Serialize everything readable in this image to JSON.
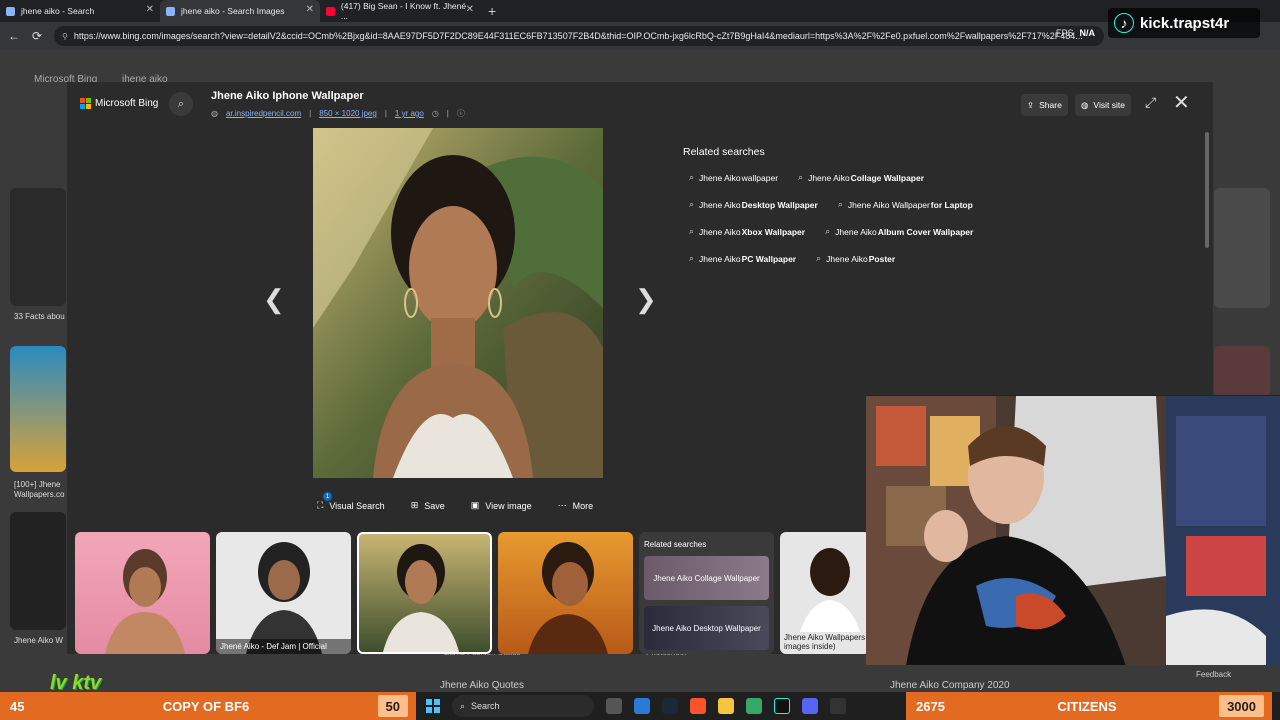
{
  "tabs": [
    {
      "title": "jhene aiko - Search",
      "active": false
    },
    {
      "title": "jhene aiko - Search Images",
      "active": true
    },
    {
      "title": "(417) Big Sean - I Know ft. Jhené ...",
      "active": false
    }
  ],
  "address": {
    "url": "https://www.bing.com/images/search?view=detailV2&ccid=OCmb%2Bjxg&id=8AAE97DF5D7F2DC89E44F311EC6FB713507F2B4D&thid=OIP.OCmb-jxg6lcRbQ-cZt7B9gHaI4&mediaurl=https%3A%2F%2Fe0.pxfuel.com%2Fwallpapers%2F717%2F484..."
  },
  "overlay": {
    "fps_label": "FPS",
    "fps_value": "N/A",
    "kick_handle": "kick.trapst4r",
    "lvktv": "lv ktv",
    "feedback": "Feedback"
  },
  "background": {
    "bing_title": "Microsoft Bing",
    "query": "jhene aiko",
    "thumb_captions": [
      "33 Facts abou",
      "[100+] Jhene",
      "Wallpapers.co",
      "Jhene Aiko W"
    ],
    "bottom_captions": [
      "Jhene Aiko Quotes",
      "Jhene Aiko Company 2020",
      "Earns Fashion Status",
      "Photoshoot"
    ]
  },
  "modal": {
    "brand": "Microsoft Bing",
    "title": "Jhene Aiko Iphone Wallpaper",
    "source": "ar.inspiredpencil.com",
    "dimensions": "850 × 1020 jpeg",
    "age": "1 yr ago",
    "share": "Share",
    "visit_site": "Visit site",
    "related_heading": "Related searches",
    "related": [
      [
        {
          "pre": "Jhene Aiko ",
          "bold": "",
          "post": "wallpaper"
        },
        {
          "pre": "Jhene Aiko ",
          "bold": "Collage Wallpaper",
          "post": ""
        }
      ],
      [
        {
          "pre": "Jhene Aiko ",
          "bold": "Desktop Wallpaper",
          "post": ""
        },
        {
          "pre": "Jhene Aiko Wallpaper ",
          "bold": "for Laptop",
          "post": ""
        }
      ],
      [
        {
          "pre": "Jhene Aiko ",
          "bold": "Xbox Wallpaper",
          "post": ""
        },
        {
          "pre": "Jhene Aiko ",
          "bold": "Album Cover Wallpaper",
          "post": ""
        }
      ],
      [
        {
          "pre": "Jhene Aiko ",
          "bold": "PC Wallpaper",
          "post": ""
        },
        {
          "pre": "Jhene Aiko ",
          "bold": "Poster",
          "post": ""
        }
      ]
    ],
    "actions": {
      "visual_search": "Visual Search",
      "visual_badge": "1",
      "save": "Save",
      "view_image": "View image",
      "more": "More"
    },
    "strip": {
      "caption_2": "Jhené Aiko - Def Jam | Official",
      "related_title": "Related searches",
      "related_a": "Jhene Aiko Collage Wallpaper",
      "related_b": "Jhene Aiko Desktop Wallpaper",
      "last_caption": "Jhene Aiko Wallpapers images inside)"
    }
  },
  "ticker": {
    "left_num": "45",
    "left_text": "COPY OF BF6",
    "left_box": "50",
    "right_num": "2675",
    "right_text": "CITIZENS",
    "right_box": "3000"
  },
  "taskbar": {
    "search": "Search"
  }
}
